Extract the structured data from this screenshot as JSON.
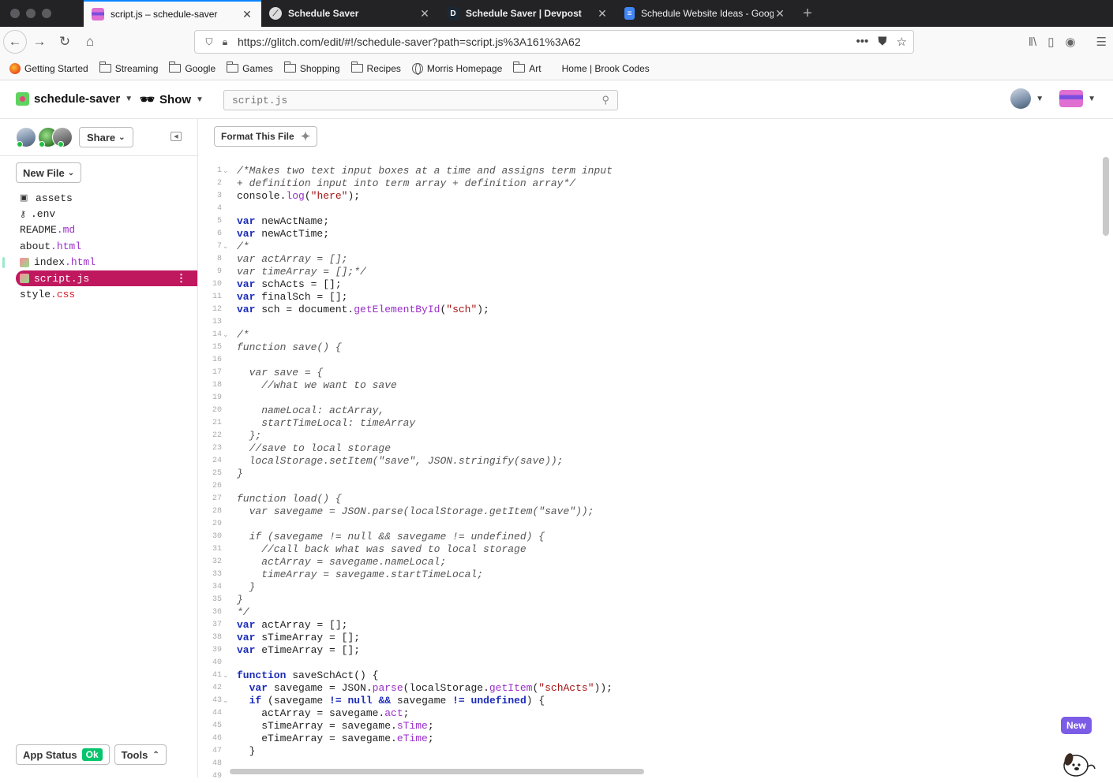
{
  "browser": {
    "tabs": [
      {
        "label": "script.js – schedule-saver",
        "active": true,
        "icon": "glitch-fish-icon"
      },
      {
        "label": "Schedule Saver",
        "active": false,
        "icon": "glitch-icon"
      },
      {
        "label": "Schedule Saver | Devpost",
        "active": false,
        "icon": "devpost-icon"
      },
      {
        "label": "Schedule Website Ideas - Goog",
        "active": false,
        "icon": "google-docs-icon"
      }
    ],
    "url": "https://glitch.com/edit/#!/schedule-saver?path=script.js%3A161%3A62",
    "bookmarks": [
      {
        "label": "Getting Started",
        "icon": "firefox-icon"
      },
      {
        "label": "Streaming",
        "icon": "folder-icon"
      },
      {
        "label": "Google",
        "icon": "folder-icon"
      },
      {
        "label": "Games",
        "icon": "folder-icon"
      },
      {
        "label": "Shopping",
        "icon": "folder-icon"
      },
      {
        "label": "Recipes",
        "icon": "folder-icon"
      },
      {
        "label": "Morris Homepage",
        "icon": "globe-icon"
      },
      {
        "label": "Art",
        "icon": "folder-icon"
      },
      {
        "label": "Home | Brook Codes",
        "icon": ""
      }
    ]
  },
  "header": {
    "project_name": "schedule-saver",
    "show_label": "Show",
    "search_placeholder": "script.js"
  },
  "sidebar": {
    "share_label": "Share",
    "new_file_label": "New File",
    "files": [
      {
        "name": "assets",
        "ext": "",
        "icon": "assets-icon"
      },
      {
        "name": ".env",
        "ext": "",
        "icon": "key-icon"
      },
      {
        "name": "README",
        "ext": ".md",
        "icon": ""
      },
      {
        "name": "about",
        "ext": ".html",
        "icon": ""
      },
      {
        "name": "index",
        "ext": ".html",
        "icon": "square"
      },
      {
        "name": "script",
        "ext": ".js",
        "icon": "square",
        "selected": true
      },
      {
        "name": "style",
        "ext": ".css",
        "icon": ""
      }
    ],
    "app_status_label": "App Status",
    "app_status_value": "Ok",
    "tools_label": "Tools"
  },
  "editor": {
    "format_label": "Format This File",
    "new_badge": "New",
    "lines": [
      {
        "n": 1,
        "fold": true,
        "t": "/*Makes two text input boxes at a time and assigns term input",
        "c": 1
      },
      {
        "n": 2,
        "t": "+ definition input into term array + definition array*/",
        "c": 1
      },
      {
        "n": 3,
        "t": "console.log(\"here\");"
      },
      {
        "n": 4,
        "t": ""
      },
      {
        "n": 5,
        "t": "var newActName;"
      },
      {
        "n": 6,
        "t": "var newActTime;"
      },
      {
        "n": 7,
        "fold": true,
        "t": "/*",
        "c": 1
      },
      {
        "n": 8,
        "t": "var actArray = [];",
        "c": 1
      },
      {
        "n": 9,
        "t": "var timeArray = [];*/",
        "c": 1
      },
      {
        "n": 10,
        "t": "var schActs = [];"
      },
      {
        "n": 11,
        "t": "var finalSch = [];"
      },
      {
        "n": 12,
        "t": "var sch = document.getElementById(\"sch\");"
      },
      {
        "n": 13,
        "t": ""
      },
      {
        "n": 14,
        "fold": true,
        "t": "/*",
        "c": 1
      },
      {
        "n": 15,
        "t": "function save() {",
        "c": 1
      },
      {
        "n": 16,
        "t": "",
        "c": 1
      },
      {
        "n": 17,
        "t": "  var save = {",
        "c": 1
      },
      {
        "n": 18,
        "t": "    //what we want to save",
        "c": 1
      },
      {
        "n": 19,
        "t": "",
        "c": 1
      },
      {
        "n": 20,
        "t": "    nameLocal: actArray,",
        "c": 1
      },
      {
        "n": 21,
        "t": "    startTimeLocal: timeArray",
        "c": 1
      },
      {
        "n": 22,
        "t": "  };",
        "c": 1
      },
      {
        "n": 23,
        "t": "  //save to local storage",
        "c": 1
      },
      {
        "n": 24,
        "t": "  localStorage.setItem(\"save\", JSON.stringify(save));",
        "c": 1
      },
      {
        "n": 25,
        "t": "}",
        "c": 1
      },
      {
        "n": 26,
        "t": "",
        "c": 1
      },
      {
        "n": 27,
        "t": "function load() {",
        "c": 1
      },
      {
        "n": 28,
        "t": "  var savegame = JSON.parse(localStorage.getItem(\"save\"));",
        "c": 1
      },
      {
        "n": 29,
        "t": "",
        "c": 1
      },
      {
        "n": 30,
        "t": "  if (savegame != null && savegame != undefined) {",
        "c": 1
      },
      {
        "n": 31,
        "t": "    //call back what was saved to local storage",
        "c": 1
      },
      {
        "n": 32,
        "t": "    actArray = savegame.nameLocal;",
        "c": 1
      },
      {
        "n": 33,
        "t": "    timeArray = savegame.startTimeLocal;",
        "c": 1
      },
      {
        "n": 34,
        "t": "  }",
        "c": 1
      },
      {
        "n": 35,
        "t": "}",
        "c": 1
      },
      {
        "n": 36,
        "t": "*/",
        "c": 1
      },
      {
        "n": 37,
        "t": "var actArray = [];"
      },
      {
        "n": 38,
        "t": "var sTimeArray = [];"
      },
      {
        "n": 39,
        "t": "var eTimeArray = [];"
      },
      {
        "n": 40,
        "t": ""
      },
      {
        "n": 41,
        "fold": true,
        "t": "function saveSchAct() {"
      },
      {
        "n": 42,
        "t": "  var savegame = JSON.parse(localStorage.getItem(\"schActs\"));"
      },
      {
        "n": 43,
        "fold": true,
        "t": "  if (savegame != null && savegame != undefined) {"
      },
      {
        "n": 44,
        "t": "    actArray = savegame.act;"
      },
      {
        "n": 45,
        "t": "    sTimeArray = savegame.sTime;"
      },
      {
        "n": 46,
        "t": "    eTimeArray = savegame.eTime;"
      },
      {
        "n": 47,
        "t": "  }"
      },
      {
        "n": 48,
        "t": ""
      },
      {
        "n": 49,
        "t": ""
      }
    ]
  }
}
